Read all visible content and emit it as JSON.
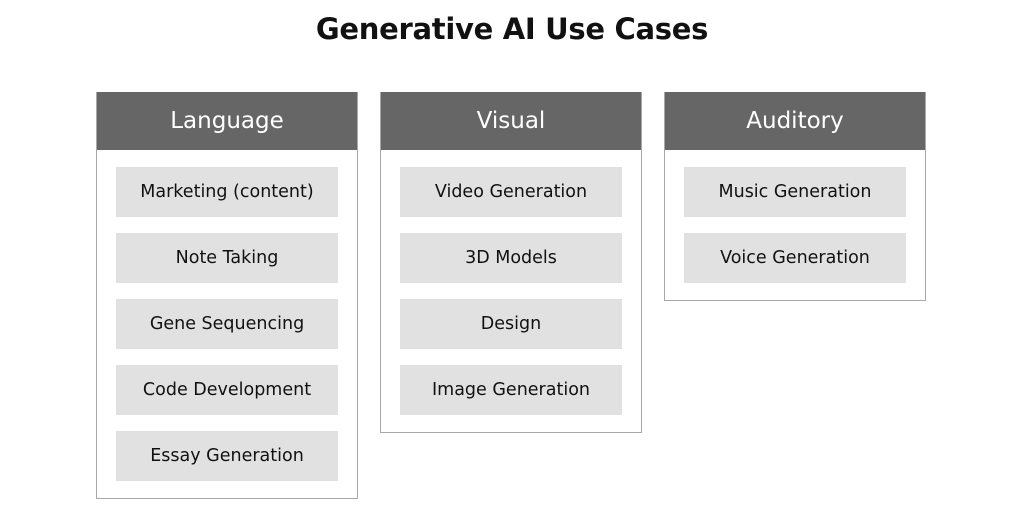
{
  "title": "Generative AI Use Cases",
  "colors": {
    "header_bg": "#666666",
    "item_bg": "#e1e1e1",
    "border": "#a8a8a8"
  },
  "panels": [
    {
      "header": "Language",
      "items": [
        "Marketing (content)",
        "Note Taking",
        "Gene Sequencing",
        "Code Development",
        "Essay Generation"
      ]
    },
    {
      "header": "Visual",
      "items": [
        "Video Generation",
        "3D Models",
        "Design",
        "Image Generation"
      ]
    },
    {
      "header": "Auditory",
      "items": [
        "Music Generation",
        "Voice Generation"
      ]
    }
  ]
}
